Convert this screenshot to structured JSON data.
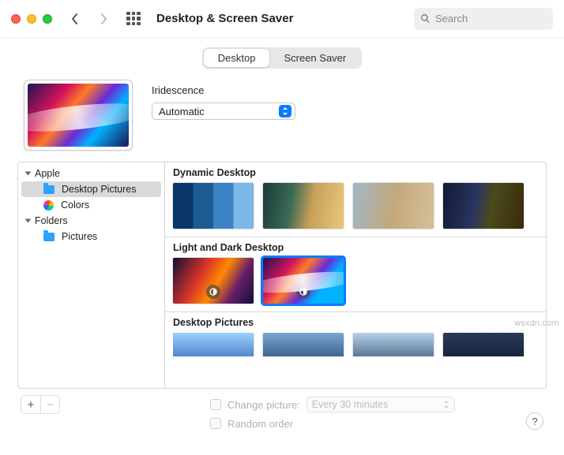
{
  "window": {
    "title": "Desktop & Screen Saver",
    "search_placeholder": "Search"
  },
  "tabs": {
    "desktop": "Desktop",
    "screensaver": "Screen Saver",
    "active": "desktop"
  },
  "current": {
    "name": "Iridescence",
    "mode_label": "Automatic"
  },
  "sidebar": {
    "groups": [
      {
        "label": "Apple",
        "children": [
          {
            "label": "Desktop Pictures",
            "icon": "folder",
            "selected": true
          },
          {
            "label": "Colors",
            "icon": "colorwheel",
            "selected": false
          }
        ]
      },
      {
        "label": "Folders",
        "children": [
          {
            "label": "Pictures",
            "icon": "folder",
            "selected": false
          }
        ]
      }
    ]
  },
  "gallery": {
    "sections": [
      {
        "title": "Dynamic Desktop"
      },
      {
        "title": "Light and Dark Desktop"
      },
      {
        "title": "Desktop Pictures"
      }
    ]
  },
  "options": {
    "change_picture_label": "Change picture:",
    "interval_label": "Every 30 minutes",
    "random_order_label": "Random order"
  },
  "watermark": "wsxdn.com"
}
